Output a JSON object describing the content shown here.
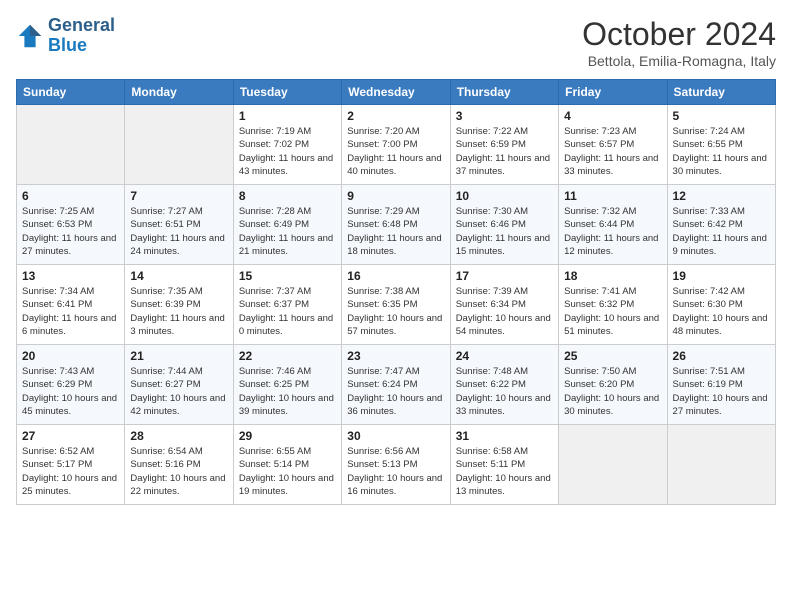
{
  "header": {
    "logo_line1": "General",
    "logo_line2": "Blue",
    "month": "October 2024",
    "location": "Bettola, Emilia-Romagna, Italy"
  },
  "weekdays": [
    "Sunday",
    "Monday",
    "Tuesday",
    "Wednesday",
    "Thursday",
    "Friday",
    "Saturday"
  ],
  "weeks": [
    [
      {
        "day": "",
        "empty": true
      },
      {
        "day": "",
        "empty": true
      },
      {
        "day": "1",
        "sunrise": "7:19 AM",
        "sunset": "7:02 PM",
        "daylight": "11 hours and 43 minutes."
      },
      {
        "day": "2",
        "sunrise": "7:20 AM",
        "sunset": "7:00 PM",
        "daylight": "11 hours and 40 minutes."
      },
      {
        "day": "3",
        "sunrise": "7:22 AM",
        "sunset": "6:59 PM",
        "daylight": "11 hours and 37 minutes."
      },
      {
        "day": "4",
        "sunrise": "7:23 AM",
        "sunset": "6:57 PM",
        "daylight": "11 hours and 33 minutes."
      },
      {
        "day": "5",
        "sunrise": "7:24 AM",
        "sunset": "6:55 PM",
        "daylight": "11 hours and 30 minutes."
      }
    ],
    [
      {
        "day": "6",
        "sunrise": "7:25 AM",
        "sunset": "6:53 PM",
        "daylight": "11 hours and 27 minutes."
      },
      {
        "day": "7",
        "sunrise": "7:27 AM",
        "sunset": "6:51 PM",
        "daylight": "11 hours and 24 minutes."
      },
      {
        "day": "8",
        "sunrise": "7:28 AM",
        "sunset": "6:49 PM",
        "daylight": "11 hours and 21 minutes."
      },
      {
        "day": "9",
        "sunrise": "7:29 AM",
        "sunset": "6:48 PM",
        "daylight": "11 hours and 18 minutes."
      },
      {
        "day": "10",
        "sunrise": "7:30 AM",
        "sunset": "6:46 PM",
        "daylight": "11 hours and 15 minutes."
      },
      {
        "day": "11",
        "sunrise": "7:32 AM",
        "sunset": "6:44 PM",
        "daylight": "11 hours and 12 minutes."
      },
      {
        "day": "12",
        "sunrise": "7:33 AM",
        "sunset": "6:42 PM",
        "daylight": "11 hours and 9 minutes."
      }
    ],
    [
      {
        "day": "13",
        "sunrise": "7:34 AM",
        "sunset": "6:41 PM",
        "daylight": "11 hours and 6 minutes."
      },
      {
        "day": "14",
        "sunrise": "7:35 AM",
        "sunset": "6:39 PM",
        "daylight": "11 hours and 3 minutes."
      },
      {
        "day": "15",
        "sunrise": "7:37 AM",
        "sunset": "6:37 PM",
        "daylight": "11 hours and 0 minutes."
      },
      {
        "day": "16",
        "sunrise": "7:38 AM",
        "sunset": "6:35 PM",
        "daylight": "10 hours and 57 minutes."
      },
      {
        "day": "17",
        "sunrise": "7:39 AM",
        "sunset": "6:34 PM",
        "daylight": "10 hours and 54 minutes."
      },
      {
        "day": "18",
        "sunrise": "7:41 AM",
        "sunset": "6:32 PM",
        "daylight": "10 hours and 51 minutes."
      },
      {
        "day": "19",
        "sunrise": "7:42 AM",
        "sunset": "6:30 PM",
        "daylight": "10 hours and 48 minutes."
      }
    ],
    [
      {
        "day": "20",
        "sunrise": "7:43 AM",
        "sunset": "6:29 PM",
        "daylight": "10 hours and 45 minutes."
      },
      {
        "day": "21",
        "sunrise": "7:44 AM",
        "sunset": "6:27 PM",
        "daylight": "10 hours and 42 minutes."
      },
      {
        "day": "22",
        "sunrise": "7:46 AM",
        "sunset": "6:25 PM",
        "daylight": "10 hours and 39 minutes."
      },
      {
        "day": "23",
        "sunrise": "7:47 AM",
        "sunset": "6:24 PM",
        "daylight": "10 hours and 36 minutes."
      },
      {
        "day": "24",
        "sunrise": "7:48 AM",
        "sunset": "6:22 PM",
        "daylight": "10 hours and 33 minutes."
      },
      {
        "day": "25",
        "sunrise": "7:50 AM",
        "sunset": "6:20 PM",
        "daylight": "10 hours and 30 minutes."
      },
      {
        "day": "26",
        "sunrise": "7:51 AM",
        "sunset": "6:19 PM",
        "daylight": "10 hours and 27 minutes."
      }
    ],
    [
      {
        "day": "27",
        "sunrise": "6:52 AM",
        "sunset": "5:17 PM",
        "daylight": "10 hours and 25 minutes."
      },
      {
        "day": "28",
        "sunrise": "6:54 AM",
        "sunset": "5:16 PM",
        "daylight": "10 hours and 22 minutes."
      },
      {
        "day": "29",
        "sunrise": "6:55 AM",
        "sunset": "5:14 PM",
        "daylight": "10 hours and 19 minutes."
      },
      {
        "day": "30",
        "sunrise": "6:56 AM",
        "sunset": "5:13 PM",
        "daylight": "10 hours and 16 minutes."
      },
      {
        "day": "31",
        "sunrise": "6:58 AM",
        "sunset": "5:11 PM",
        "daylight": "10 hours and 13 minutes."
      },
      {
        "day": "",
        "empty": true
      },
      {
        "day": "",
        "empty": true
      }
    ]
  ]
}
